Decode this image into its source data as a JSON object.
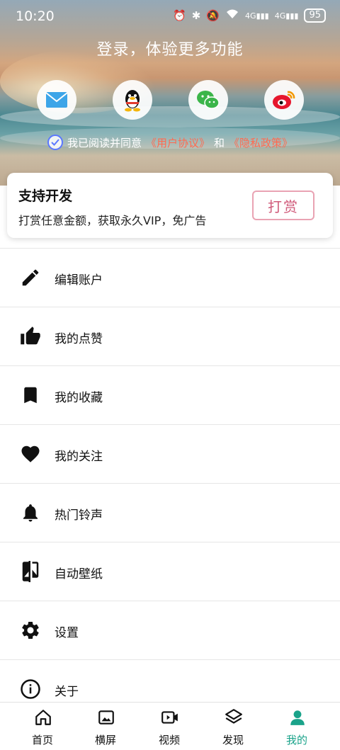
{
  "status_bar": {
    "time": "10:20",
    "network_1": "4G",
    "network_2": "4G",
    "battery": "95"
  },
  "login": {
    "title": "登录，体验更多功能",
    "agreement_prefix": "我已阅读并同意",
    "user_agreement": "《用户协议》",
    "conjunction": "和",
    "privacy_policy": "《隐私政策》",
    "methods": [
      {
        "name": "email",
        "icon": "envelope-icon"
      },
      {
        "name": "qq",
        "icon": "qq-penguin-icon"
      },
      {
        "name": "wechat",
        "icon": "wechat-icon"
      },
      {
        "name": "weibo",
        "icon": "weibo-icon"
      }
    ]
  },
  "support_card": {
    "title": "支持开发",
    "subtitle": "打赏任意金额，获取永久VIP，免广告",
    "button": "打赏"
  },
  "menu": [
    {
      "label": "编辑账户",
      "icon": "pencil-icon"
    },
    {
      "label": "我的点赞",
      "icon": "thumbs-up-icon"
    },
    {
      "label": "我的收藏",
      "icon": "bookmark-icon"
    },
    {
      "label": "我的关注",
      "icon": "heart-icon"
    },
    {
      "label": "热门铃声",
      "icon": "bell-icon"
    },
    {
      "label": "自动壁纸",
      "icon": "wallpaper-switch-icon"
    },
    {
      "label": "设置",
      "icon": "gear-icon"
    },
    {
      "label": "关于",
      "icon": "info-icon"
    }
  ],
  "tabs": [
    {
      "label": "首页",
      "icon": "home-icon"
    },
    {
      "label": "横屏",
      "icon": "image-icon"
    },
    {
      "label": "视频",
      "icon": "video-icon"
    },
    {
      "label": "发现",
      "icon": "layers-icon"
    },
    {
      "label": "我的",
      "icon": "person-icon",
      "active": true
    }
  ],
  "colors": {
    "accent": "#1aa38a",
    "link": "#ff6a50",
    "reward_border": "#e9a3b3"
  }
}
